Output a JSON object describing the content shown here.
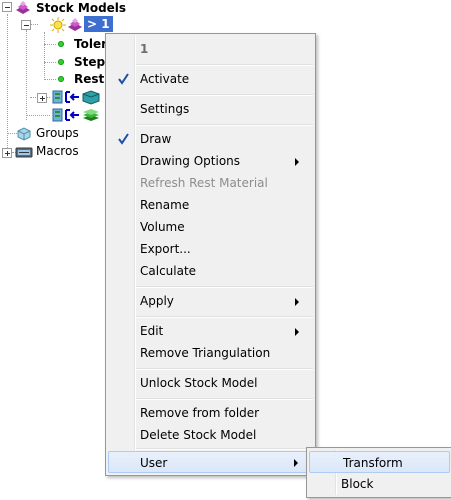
{
  "tree": {
    "root_label": "Stock Models",
    "selected_item_label": "> 1",
    "children": [
      "Tolera",
      "Stepo",
      "Rest T"
    ],
    "groups_label": "Groups",
    "macros_label": "Macros"
  },
  "context_menu": {
    "header": "1",
    "activate": "Activate",
    "settings": "Settings",
    "draw": "Draw",
    "drawing_options": "Drawing Options",
    "refresh_rest_material": "Refresh Rest Material",
    "rename": "Rename",
    "volume": "Volume",
    "export": "Export...",
    "calculate": "Calculate",
    "apply": "Apply",
    "edit": "Edit",
    "remove_triangulation": "Remove Triangulation",
    "unlock_stock_model": "Unlock Stock Model",
    "remove_from_folder": "Remove from folder",
    "delete_stock_model": "Delete Stock Model",
    "user": "User"
  },
  "submenu": {
    "transform": "Transform",
    "block": "Block"
  },
  "colors": {
    "selection": "#3d6fd1",
    "check": "#1f4fa8",
    "menu_bg": "#f0f0f0",
    "highlight_border": "#aecbf1"
  }
}
